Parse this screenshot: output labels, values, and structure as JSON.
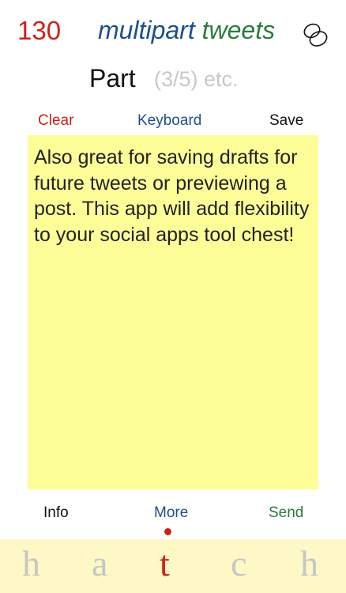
{
  "header": {
    "char_count": "130",
    "title_part1": "multipart",
    "title_part2": "tweets",
    "logo_icon": "overlapping-ovals-icon"
  },
  "part_row": {
    "label": "Part",
    "hint": "(3/5) etc."
  },
  "toolbar": {
    "clear_label": "Clear",
    "keyboard_label": "Keyboard",
    "save_label": "Save"
  },
  "note": {
    "text": "Also great for saving drafts for future tweets or previewing a post. This app will add flexibility to your social apps tool chest!"
  },
  "bottom_bar": {
    "info_label": "Info",
    "more_label": "More",
    "send_label": "Send",
    "active_indicator": "more"
  },
  "hatch_bar": {
    "letters": [
      "h",
      "a",
      "t",
      "c",
      "h"
    ],
    "active_index": 2
  },
  "colors": {
    "red": "#d0201b",
    "blue": "#1d4f8c",
    "green": "#2a7a3c",
    "note_yellow": "#fefe99",
    "hatch_bar_bg": "#fdf8c6",
    "inactive_letter": "#c6c6c6"
  }
}
